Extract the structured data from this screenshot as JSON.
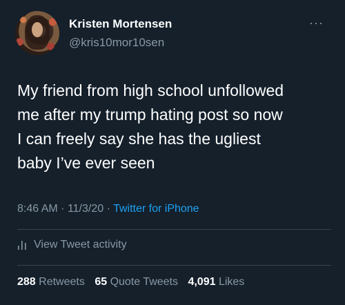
{
  "user": {
    "name": "Kristen Mortensen",
    "handle": "@kris10mor10sen"
  },
  "more_glyph": "···",
  "tweet": {
    "text": "My friend from high school unfollowed\nme after my trump hating post so now\nI can freely say she has the ugliest\nbaby I’ve ever seen",
    "time": "8:46 AM",
    "date": "11/3/20",
    "separator": "·",
    "source": "Twitter for iPhone"
  },
  "activity": {
    "label": "View Tweet activity"
  },
  "stats": {
    "retweets_count": "288",
    "retweets_label": "Retweets",
    "quotes_count": "65",
    "quotes_label": "Quote Tweets",
    "likes_count": "4,091",
    "likes_label": "Likes"
  },
  "colors": {
    "background": "#15202b",
    "text_primary": "#ffffff",
    "text_secondary": "#8899a6",
    "link": "#1da1f2",
    "divider": "#38444d"
  }
}
